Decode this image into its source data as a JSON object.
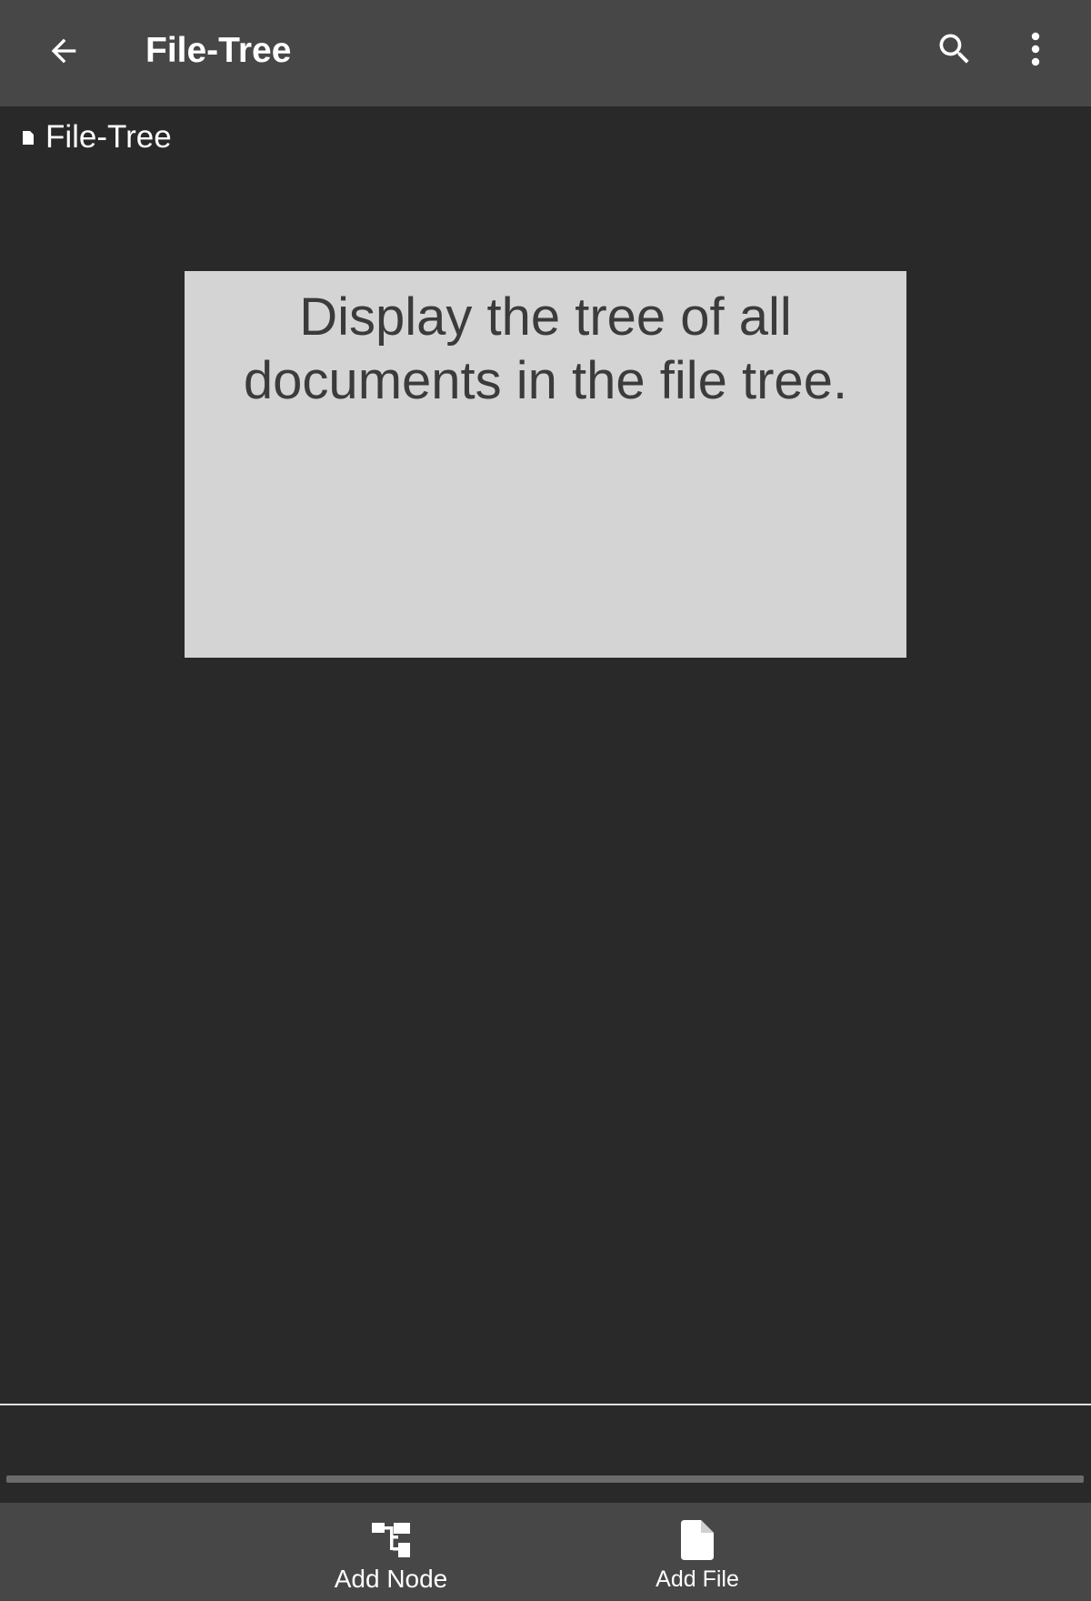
{
  "appbar": {
    "title": "File-Tree",
    "back_icon": "arrow-left-icon",
    "search_icon": "search-icon",
    "more_icon": "more-vertical-icon"
  },
  "tree": {
    "root_label": "File-Tree",
    "root_icon": "file-icon"
  },
  "info_box": {
    "text": "Display the tree of all documents in the file tree."
  },
  "bottombar": {
    "add_node_label": "Add Node",
    "add_node_icon": "tree-node-icon",
    "add_file_label": "Add File",
    "add_file_icon": "file-icon"
  },
  "colors": {
    "background": "#292929",
    "bar": "#474747",
    "info_box": "#d4d4d4",
    "info_text": "#3b3b3b"
  }
}
